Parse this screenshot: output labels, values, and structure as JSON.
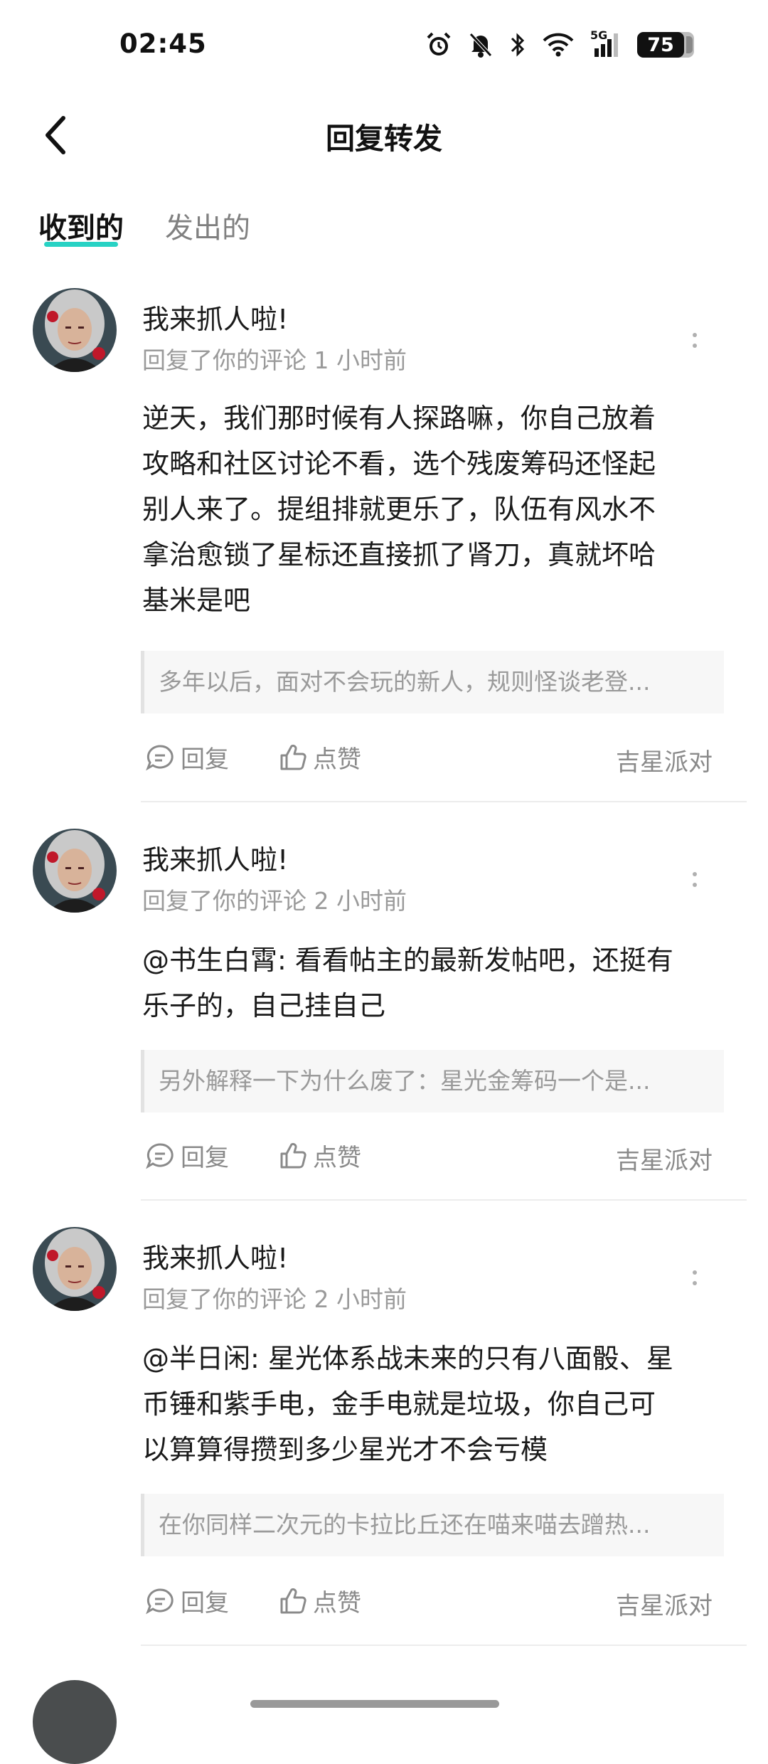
{
  "status_bar": {
    "time": "02:45",
    "network": "5G",
    "battery": "75",
    "icons": [
      "alarm-icon",
      "bell-off-icon",
      "bluetooth-icon",
      "wifi-icon",
      "signal-icon",
      "battery-icon"
    ]
  },
  "header": {
    "title": "回复转发",
    "back_icon": "chevron-left-icon"
  },
  "tabs": [
    {
      "label": "收到的",
      "active": true
    },
    {
      "label": "发出的",
      "active": false
    }
  ],
  "colors": {
    "accent": "#28d2c4",
    "text_primary": "#1a1a1a",
    "text_secondary": "#9a9a9a"
  },
  "items": [
    {
      "username": "我来抓人啦!",
      "meta": "回复了你的评论 1 小时前",
      "comment": "逆天，我们那时候有人探路嘛，你自己放着\n攻略和社区讨论不看，选个残废筹码还怪起\n别人来了。提组排就更乐了，队伍有风水不\n拿治愈锁了星标还直接抓了肾刀，真就坏哈\n基米是吧",
      "quote": "多年以后，面对不会玩的新人，规则怪谈老登...",
      "reply_label": "回复",
      "like_label": "点赞",
      "source": "吉星派对"
    },
    {
      "username": "我来抓人啦!",
      "meta": "回复了你的评论 2 小时前",
      "comment": "@书生白霄: 看看帖主的最新发帖吧，还挺有\n乐子的，自己挂自己",
      "quote": "另外解释一下为什么废了：星光金筹码一个是...",
      "reply_label": "回复",
      "like_label": "点赞",
      "source": "吉星派对"
    },
    {
      "username": "我来抓人啦!",
      "meta": "回复了你的评论 2 小时前",
      "comment": "@半日闲: 星光体系战未来的只有八面骰、星\n币锤和紫手电，金手电就是垃圾，你自己可\n以算算得攒到多少星光才不会亏模",
      "quote": "在你同样二次元的卡拉比丘还在喵来喵去蹭热...",
      "reply_label": "回复",
      "like_label": "点赞",
      "source": "吉星派对"
    }
  ]
}
